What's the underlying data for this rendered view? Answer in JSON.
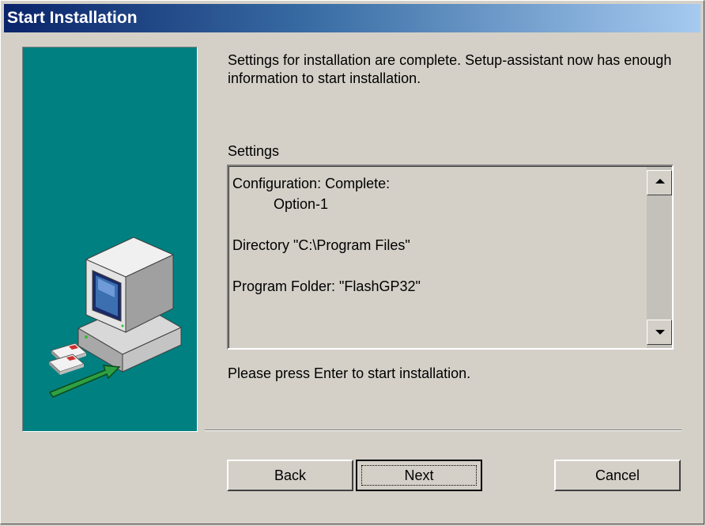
{
  "window": {
    "title": "Start Installation"
  },
  "intro_text": "Settings for installation are complete. Setup-assistant now has enough information to start installation.",
  "settings": {
    "label": "Settings",
    "lines": {
      "configuration": "Configuration: Complete:",
      "option": "Option-1",
      "directory": "Directory \"C:\\Program Files\"",
      "program_folder": "Program Folder: \"FlashGP32\""
    }
  },
  "hint_text": "Please press Enter to start installation.",
  "buttons": {
    "back": "Back",
    "next": "Next",
    "cancel": "Cancel"
  },
  "colors": {
    "titlebar_start": "#0a246a",
    "titlebar_end": "#a6caf0",
    "side_panel": "#008080",
    "dialog_face": "#d4d0c8"
  },
  "icons": [
    "computer-icon",
    "floppy-disks-icon",
    "green-arrow-icon",
    "scroll-up-arrow-icon",
    "scroll-down-arrow-icon"
  ]
}
